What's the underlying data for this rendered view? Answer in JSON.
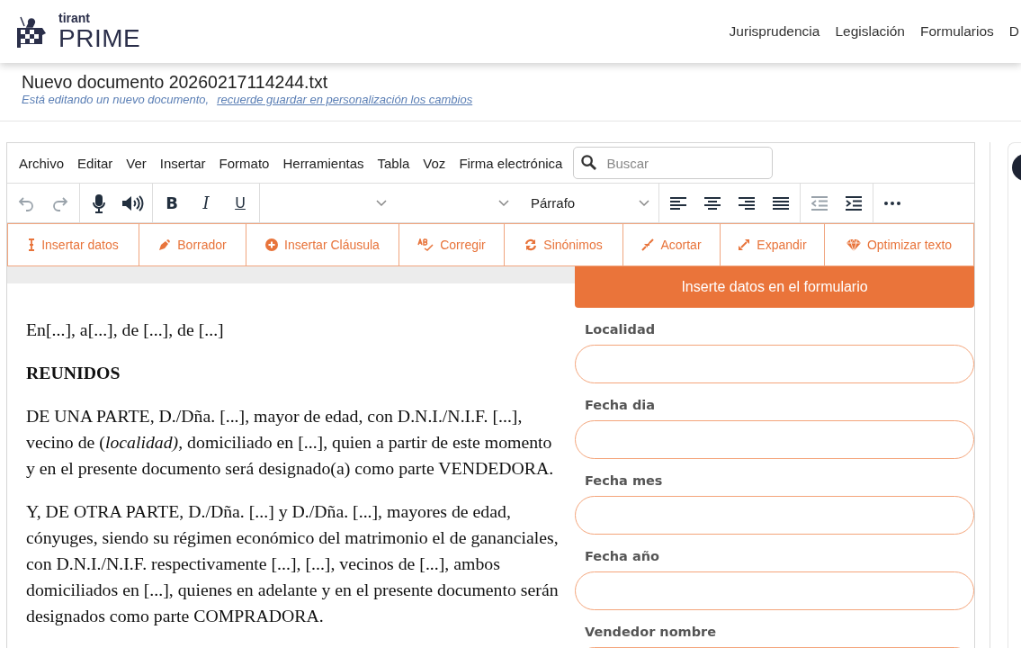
{
  "header": {
    "brand_small": "tirant",
    "brand_large": "PRIME",
    "nav": [
      "Jurisprudencia",
      "Legislación",
      "Formularios",
      "D"
    ]
  },
  "document": {
    "title": "Nuevo documento 20260217114244.txt",
    "notice": "Está editando un nuevo documento,",
    "notice_link": "recuerde guardar en personalización los cambios"
  },
  "editor": {
    "menu": [
      "Archivo",
      "Editar",
      "Ver",
      "Insertar",
      "Formato",
      "Herramientas",
      "Tabla",
      "Voz",
      "Firma electrónica"
    ],
    "search": {
      "placeholder": "Buscar"
    },
    "toolbar": [
      {
        "kind": "group",
        "items": [
          {
            "disabled": true
          },
          {
            "disabled": true
          }
        ]
      },
      {
        "kind": "group",
        "items": [
          {
            "disabled": false
          },
          {
            "disabled": false
          }
        ]
      },
      {
        "kind": "group",
        "items": [
          {
            "text": "B",
            "disabled": false
          },
          {
            "text": "I",
            "disabled": false
          },
          {
            "text": "U",
            "disabled": false
          }
        ]
      },
      {
        "kind": "select"
      },
      {
        "kind": "select"
      },
      {
        "kind": "select",
        "value": "Párrafo"
      },
      {
        "kind": "group",
        "items": [
          {
            "disabled": false
          },
          {
            "disabled": false
          },
          {
            "disabled": false
          },
          {
            "disabled": false
          }
        ]
      },
      {
        "kind": "group",
        "items": [
          {
            "disabled": true
          },
          {
            "disabled": false
          }
        ]
      },
      {
        "kind": "group",
        "items": [
          {
            "disabled": false
          }
        ]
      }
    ],
    "ai_actions": [
      {
        "label": "Insertar datos"
      },
      {
        "label": "Borrador"
      },
      {
        "label": "Insertar Cláusula"
      },
      {
        "label": "Corregir"
      },
      {
        "label": "Sinónimos"
      },
      {
        "label": "Acortar"
      },
      {
        "label": "Expandir"
      },
      {
        "label": "Optimizar texto"
      }
    ],
    "content": [
      {
        "kind": "para",
        "text": "En[...], a[...], de [...], de [...]"
      },
      {
        "kind": "heading",
        "text": "REUNIDOS"
      },
      {
        "kind": "para",
        "text": "DE UNA PARTE, D./Dña. [...], mayor de edad, con D.N.I./N.I.F. [...], vecino de (*localidad),* domiciliado en [...], quien a partir de este momento y en el presente documento será designado(a) como parte VENDEDORA."
      },
      {
        "kind": "para",
        "text": "Y, DE OTRA PARTE, D./Dña. [...] y D./Dña. [...], mayores de edad, cónyuges, siendo su régimen económico del matrimonio el de gananciales, con D.N.I./N.I.F. respectivamente [...], [...], vecinos de [...], ambos domiciliados en [...], quienes en adelante y en el presente documento serán designados como parte COMPRADORA."
      }
    ]
  },
  "form": {
    "title": "Inserte datos en el formulario",
    "fields": [
      {
        "label": "Localidad"
      },
      {
        "label": "Fecha dia"
      },
      {
        "label": "Fecha mes"
      },
      {
        "label": "Fecha año"
      },
      {
        "label": "Vendedor nombre"
      }
    ]
  }
}
